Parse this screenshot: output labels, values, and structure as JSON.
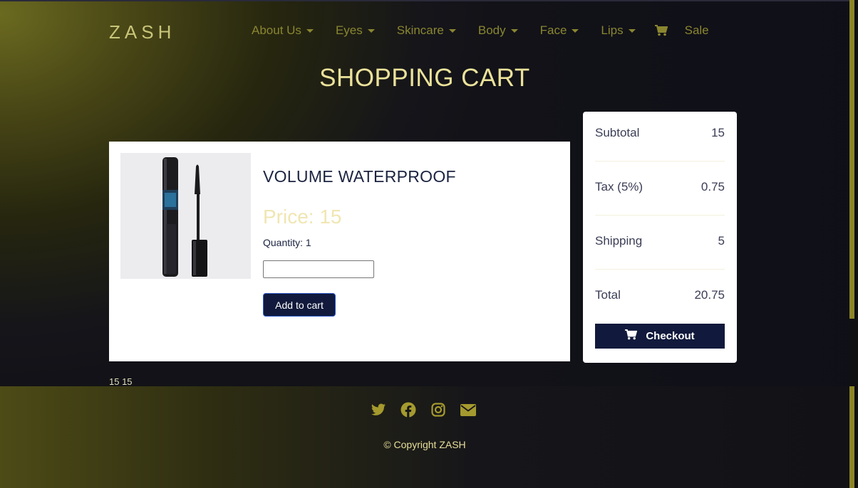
{
  "navbar": {
    "brand": "ZASH",
    "items": [
      {
        "label": "About Us"
      },
      {
        "label": "Eyes"
      },
      {
        "label": "Skincare"
      },
      {
        "label": "Body"
      },
      {
        "label": "Face"
      },
      {
        "label": "Lips"
      }
    ],
    "cart_icon": "cart-icon",
    "sale_label": "Sale"
  },
  "page": {
    "title": "SHOPPING CART"
  },
  "product": {
    "name": "VOLUME WATERPROOF",
    "price_label": "Price: 15",
    "quantity_label": "Quantity: 1",
    "quantity_input_value": "",
    "add_button_label": "Add to cart",
    "image": "mascara-product-image"
  },
  "under_text": "15 15",
  "summary": {
    "subtotal_label": "Subtotal",
    "subtotal_value": "15",
    "tax_label": "Tax (5%)",
    "tax_value": "0.75",
    "shipping_label": "Shipping",
    "shipping_value": "5",
    "total_label": "Total",
    "total_value": "20.75",
    "checkout_label": "Checkout"
  },
  "footer": {
    "socials": [
      "twitter-icon",
      "facebook-icon",
      "instagram-icon",
      "mail-icon"
    ],
    "copyright": "© Copyright ZASH"
  },
  "colors": {
    "accent_gold": "#ebe29a",
    "nav_olive": "#8a8630",
    "button_navy": "#111a3c"
  }
}
